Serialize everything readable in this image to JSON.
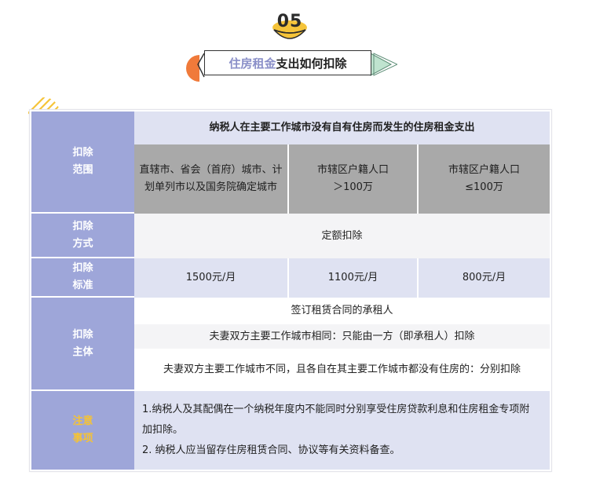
{
  "header": {
    "number": "05",
    "title_highlight": "住房租金",
    "title_rest": "支出如何扣除"
  },
  "colors": {
    "accent_lavender": "#9ea6d9",
    "light_lavender": "#dfe2f2",
    "gray_cell": "#a9a9a9",
    "notes_heading": "#f6c334",
    "orange": "#f07a3a",
    "green": "#bfe3cf"
  },
  "table": {
    "rows": {
      "scope_label": "扣除\n范围",
      "method_label": "扣除\n方式",
      "standard_label": "扣除\n标准",
      "subject_label": "扣除\n主体",
      "notes_label": "注意\n事项"
    },
    "scope_title": "纳税人在主要工作城市没有自有住房而发生的住房租金支出",
    "city_categories": [
      "直辖市、省会（首府）城市、计划单列市以及国务院确定城市",
      "市辖区户籍人口\n＞100万",
      "市辖区户籍人口\n≤100万"
    ],
    "method": "定额扣除",
    "standards": [
      "1500元/月",
      "1100元/月",
      "800元/月"
    ],
    "subjects": [
      "签订租赁合同的承租人",
      "夫妻双方主要工作城市相同：只能由一方（即承租人）扣除",
      "夫妻双方主要工作城市不同，且各自在其主要工作城市都没有住房的：分别扣除"
    ],
    "notes": [
      "1.纳税人及其配偶在一个纳税年度内不能同时分别享受住房贷款利息和住房租金专项附加扣除。",
      "2. 纳税人应当留存住房租赁合同、协议等有关资料备查。"
    ]
  }
}
